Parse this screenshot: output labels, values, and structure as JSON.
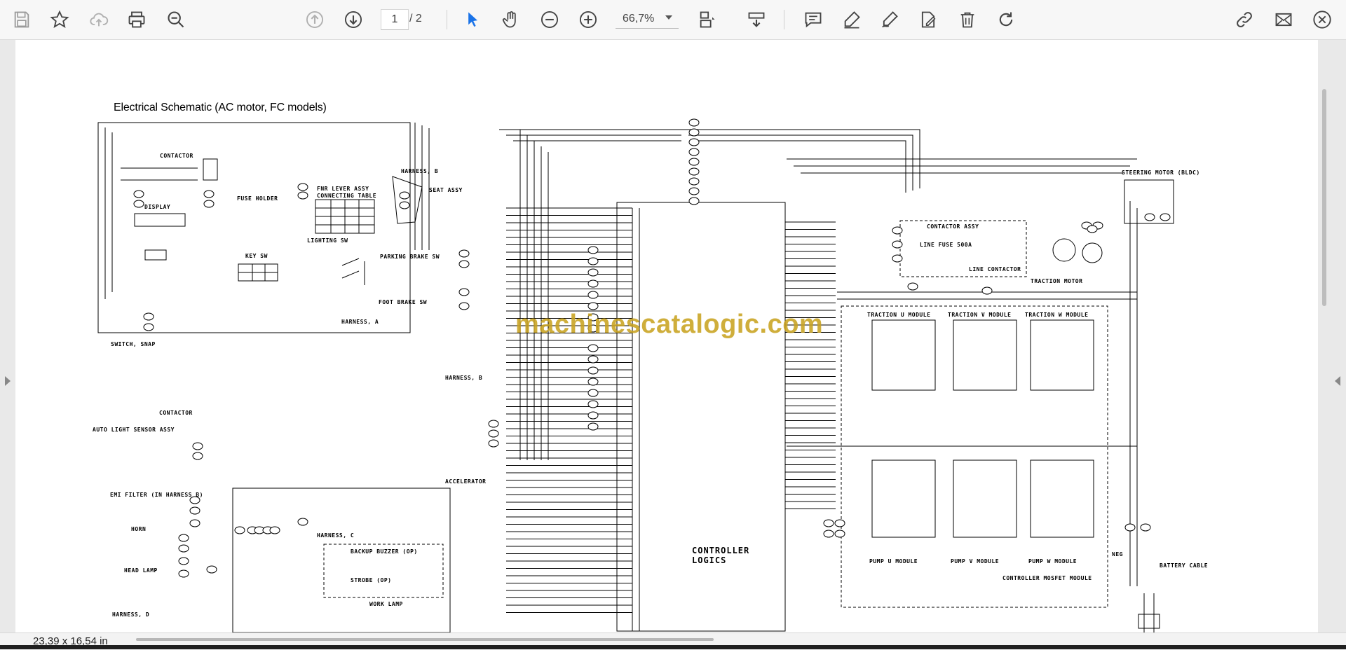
{
  "toolbar": {
    "icons": [
      "save-icon",
      "star-icon",
      "cloud-upload-icon",
      "print-icon",
      "zoom-out-search-icon",
      "page-up-icon",
      "page-down-icon",
      "select-cursor-icon",
      "hand-pan-icon",
      "zoom-out-icon",
      "zoom-in-icon",
      "fit-page-icon",
      "scroll-mode-icon",
      "comment-icon",
      "highlight-pen-icon",
      "draw-pen-icon",
      "fill-sign-icon",
      "delete-icon",
      "rotate-icon",
      "share-link-icon",
      "email-icon",
      "close-icon"
    ],
    "page_current": "1",
    "page_total": "/ 2",
    "zoom": "66,7%",
    "accent_color": "#1a73e8"
  },
  "document": {
    "title": "Electrical Schematic (AC motor, FC models)",
    "watermark": "machinescatalogic.com",
    "labels": {
      "contactor_top": "CONTACTOR",
      "display": "DISPLAY",
      "fuse_holder": "FUSE HOLDER",
      "fnr_lever": "FNR LEVER ASSY",
      "connecting_table": "CONNECTING TABLE",
      "lighting_sw": "LIGHTING SW",
      "key_sw": "KEY SW",
      "harness_a": "HARNESS, A",
      "harness_b": "HARNESS, B",
      "harness_c": "HARNESS, C",
      "harness_d": "HARNESS, D",
      "seat_assy": "SEAT ASSY",
      "parking_brake": "PARKING BRAKE SW",
      "foot_brake": "FOOT BRAKE SW",
      "switch_snap": "SWITCH, SNAP",
      "contactor_mid": "CONTACTOR",
      "auto_light": "AUTO LIGHT SENSOR ASSY",
      "emi_filter": "EMI FILTER (IN HARNESS B)",
      "horn": "HORN",
      "head_lamp": "HEAD LAMP",
      "backup_buzzer": "BACKUP BUZZER (OP)",
      "strobe": "STROBE (OP)",
      "work_lamp": "WORK LAMP",
      "accelerator": "ACCELERATOR",
      "controller_logics": "CONTROLLER LOGICS",
      "traction_u": "TRACTION U MODULE",
      "traction_v": "TRACTION V MODULE",
      "traction_w": "TRACTION W MODULE",
      "pump_u": "PUMP U MODULE",
      "pump_v": "PUMP V MODULE",
      "pump_w": "PUMP W MODULE",
      "contactor_assy": "CONTACTOR ASSY",
      "line_fuse": "LINE FUSE 500A",
      "line_contactor": "LINE CONTACTOR",
      "traction_motor": "TRACTION MOTOR",
      "steering_motor": "STEERING MOTOR (BLDC)",
      "battery_cable": "BATTERY CABLE",
      "controller_mosfet": "CONTROLLER MOSFET MODULE",
      "neg": "NEG"
    }
  },
  "status": {
    "page_dims": "23,39 x 16,54 in"
  }
}
